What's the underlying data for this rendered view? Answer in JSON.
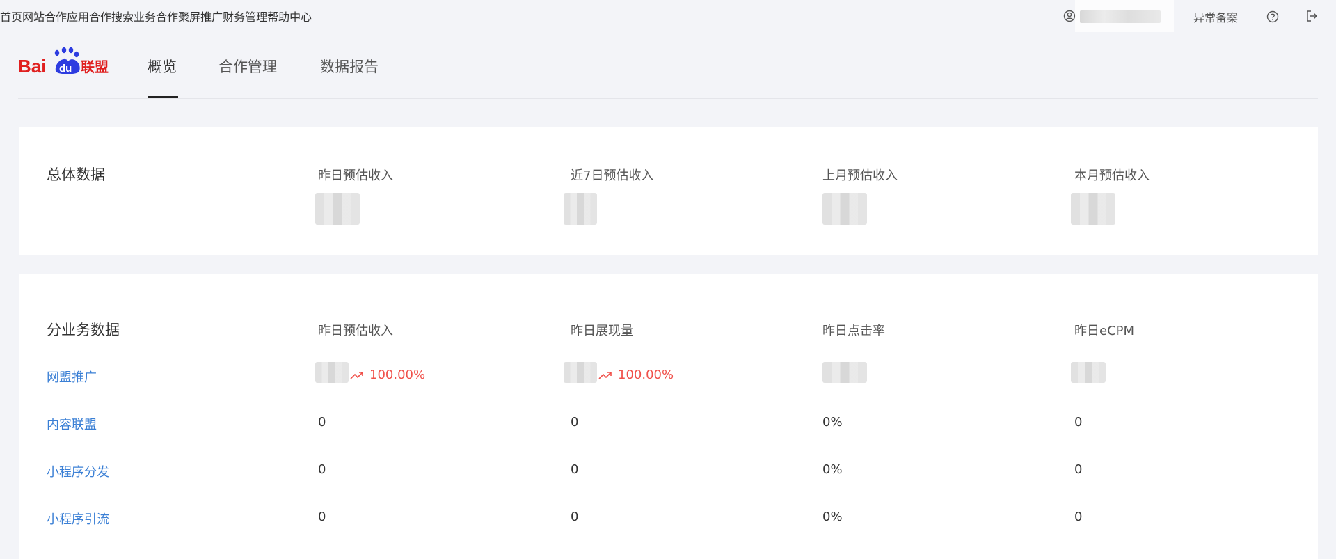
{
  "top_nav": {
    "items": [
      "首页",
      "网站合作",
      "应用合作",
      "搜索业务合作",
      "聚屏推广",
      "财务管理",
      "帮助中心"
    ],
    "abnormal": "异常备案"
  },
  "colors": {
    "link": "#3a7fd5",
    "trend_up": "#f0504a",
    "logo_red": "#e02020",
    "logo_blue": "#2d3ce0"
  },
  "brand": {
    "logo_text": "Bai",
    "logo_du": "du",
    "logo_cn": "联盟",
    "tabs": [
      "概览",
      "合作管理",
      "数据报告"
    ],
    "active_tab": "概览"
  },
  "overall": {
    "title": "总体数据",
    "columns": [
      "昨日预估收入",
      "近7日预估收入",
      "上月预估收入",
      "本月预估收入"
    ]
  },
  "business": {
    "title": "分业务数据",
    "columns": [
      "昨日预估收入",
      "昨日展现量",
      "昨日点击率",
      "昨日eCPM"
    ],
    "rows": [
      {
        "name": "网盟推广",
        "values": [
          "",
          "",
          "",
          ""
        ],
        "trends": [
          "100.00%",
          "100.00%"
        ]
      },
      {
        "name": "内容联盟",
        "values": [
          "0",
          "0",
          "0%",
          "0"
        ]
      },
      {
        "name": "小程序分发",
        "values": [
          "0",
          "0",
          "0%",
          "0"
        ]
      },
      {
        "name": "小程序引流",
        "values": [
          "0",
          "0",
          "0%",
          "0"
        ]
      }
    ]
  }
}
